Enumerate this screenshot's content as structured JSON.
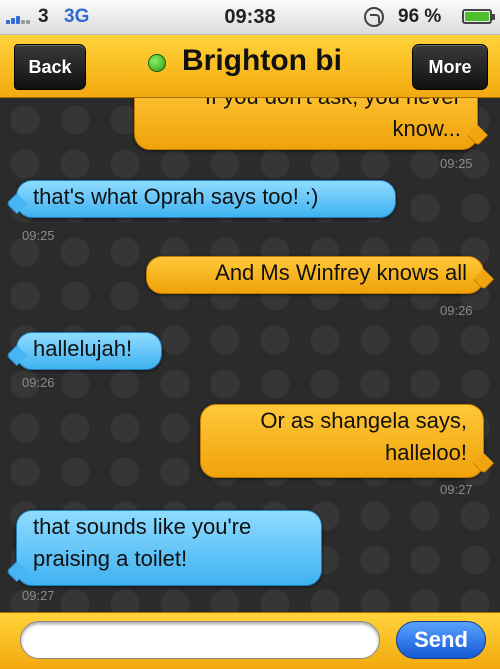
{
  "status_bar": {
    "carrier": "3",
    "network": "3G",
    "time": "09:38",
    "battery": "96 %",
    "icons": [
      "signal-icon",
      "rotation-lock-icon",
      "battery-icon"
    ]
  },
  "header": {
    "back_label": "Back",
    "title": "Brighton bi",
    "more_label": "More",
    "online_status_color": "#3fae1c"
  },
  "messages": [
    {
      "from": "me",
      "lines": [
        "If you don't ask, you never",
        "know..."
      ],
      "time": "09:25"
    },
    {
      "from": "them",
      "lines": [
        "that's what Oprah says too! :)"
      ],
      "time": "09:25"
    },
    {
      "from": "me",
      "lines": [
        "And Ms Winfrey knows all"
      ],
      "time": "09:26"
    },
    {
      "from": "them",
      "lines": [
        "hallelujah!"
      ],
      "time": "09:26"
    },
    {
      "from": "me",
      "lines": [
        "Or as shangela says,",
        "halleloo!"
      ],
      "time": "09:27"
    },
    {
      "from": "them",
      "lines": [
        "that sounds like you're",
        "praising a toilet!"
      ],
      "time": "09:27"
    }
  ],
  "composer": {
    "placeholder": "",
    "send_label": "Send"
  },
  "colors": {
    "sent_bubble": "#f5b21f",
    "received_bubble": "#5cc3f7",
    "toolbar": "#f8bd1e",
    "send_button": "#2b6fe6"
  }
}
